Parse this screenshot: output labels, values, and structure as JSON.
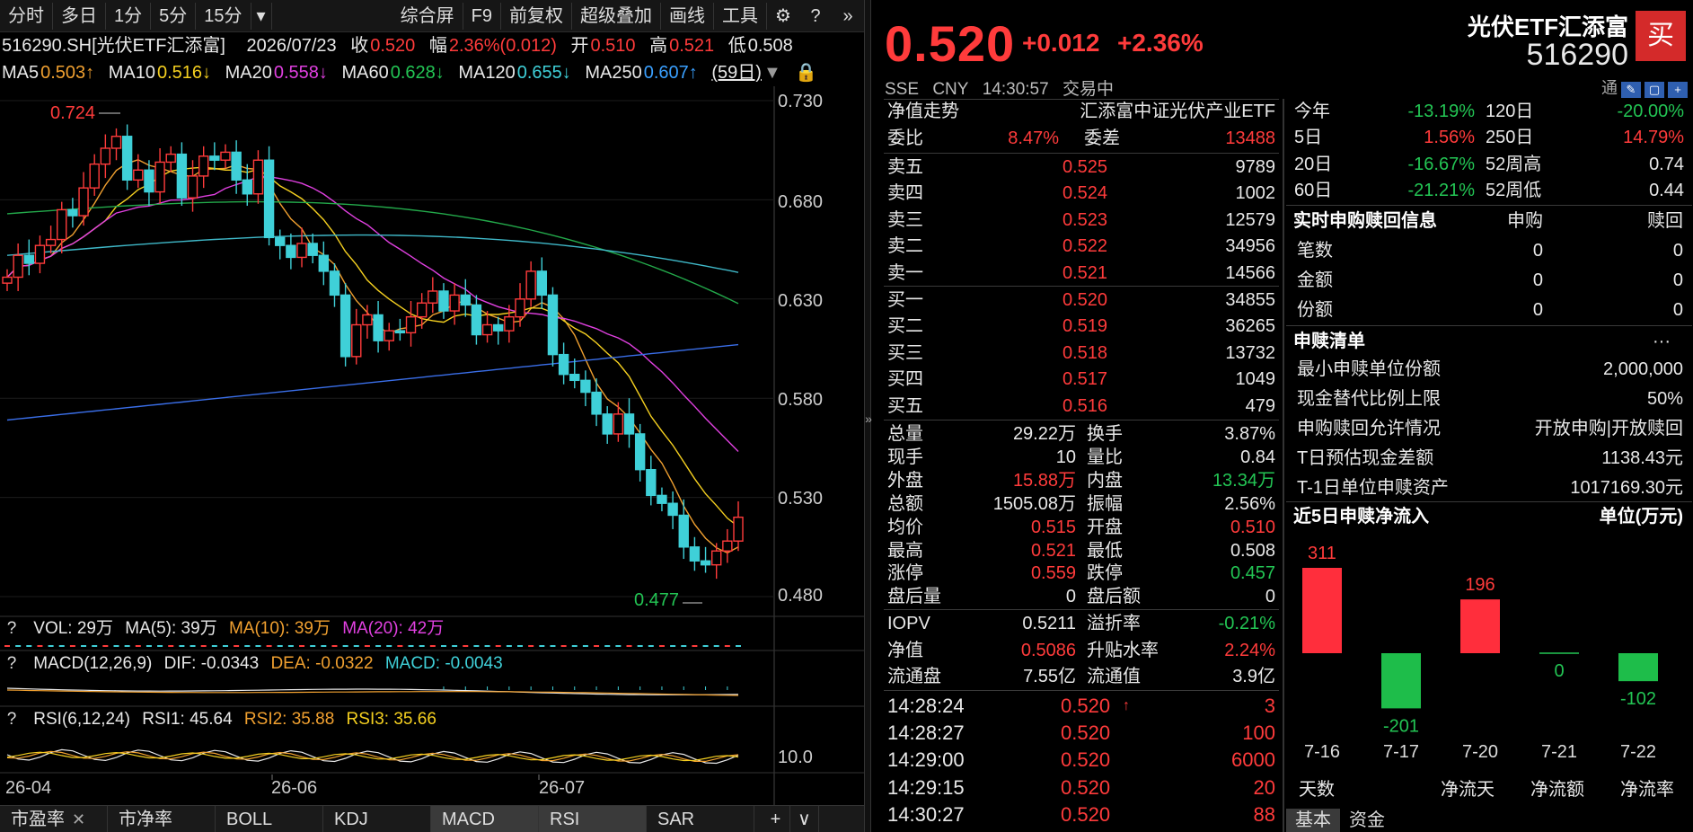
{
  "toolbar": {
    "items": [
      "分时",
      "多日",
      "1分",
      "5分",
      "15分",
      "综合屏",
      "F9",
      "前复权",
      "超级叠加",
      "画线",
      "工具"
    ],
    "more": "▾",
    "gear": "⚙",
    "help": "?",
    "collapse": "»"
  },
  "info": {
    "code": "516290.SH[光伏ETF汇添富]",
    "date": "2026/07/23",
    "close_label": "收",
    "close": "0.520",
    "range_label": "幅",
    "range": "2.36%(0.012)",
    "open_label": "开",
    "open": "0.510",
    "high_label": "高",
    "high": "0.521",
    "low_label": "低",
    "low": "0.508"
  },
  "ma": {
    "ma5": "MA5",
    "ma5v": "0.503↑",
    "ma10": "MA10",
    "ma10v": "0.516↓",
    "ma20": "MA20",
    "ma20v": "0.558↓",
    "ma60": "MA60",
    "ma60v": "0.628↓",
    "ma120": "MA120",
    "ma120v": "0.655↓",
    "ma250": "MA250",
    "ma250v": "0.607↑",
    "days": "(59日)"
  },
  "price_axis": [
    "0.730",
    "0.680",
    "0.630",
    "0.580",
    "0.530",
    "0.480"
  ],
  "annot": {
    "high": "0.724",
    "low": "0.477"
  },
  "vol": {
    "q": "?",
    "label": "VOL: 29万",
    "ma5": "MA(5): 39万",
    "ma10": "MA(10): 39万",
    "ma20": "MA(20): 42万"
  },
  "macd": {
    "q": "?",
    "label": "MACD(12,26,9)",
    "dif": "DIF: -0.0343",
    "dea": "DEA: -0.0322",
    "macd": "MACD: -0.0043"
  },
  "rsi": {
    "q": "?",
    "label": "RSI(6,12,24)",
    "rsi1": "RSI1: 45.64",
    "rsi2": "RSI2: 35.88",
    "rsi3": "RSI3: 35.66",
    "axis": "10.0"
  },
  "xaxis": [
    "26-04",
    "26-06",
    "26-07"
  ],
  "bottom_tabs": [
    "市盈率",
    "市净率",
    "BOLL",
    "KDJ",
    "MACD",
    "RSI",
    "SAR"
  ],
  "bottom_tab_close": "✕",
  "bottom_icons": [
    "+",
    "∨"
  ],
  "quote": {
    "price": "0.520",
    "change": "+0.012",
    "pct": "+2.36%",
    "exchange": "SSE",
    "currency": "CNY",
    "time": "14:30:57",
    "status": "交易中",
    "name": "光伏ETF汇添富",
    "code": "516290",
    "buy": "买",
    "tong": "通"
  },
  "nav": {
    "label": "净值走势",
    "fund": "汇添富中证光伏产业ETF"
  },
  "wei": {
    "wb_label": "委比",
    "wb": "8.47%",
    "wc_label": "委差",
    "wc": "13488"
  },
  "asks": [
    {
      "l": "卖五",
      "p": "0.525",
      "v": "9789"
    },
    {
      "l": "卖四",
      "p": "0.524",
      "v": "1002"
    },
    {
      "l": "卖三",
      "p": "0.523",
      "v": "12579"
    },
    {
      "l": "卖二",
      "p": "0.522",
      "v": "34956"
    },
    {
      "l": "卖一",
      "p": "0.521",
      "v": "14566"
    }
  ],
  "bids": [
    {
      "l": "买一",
      "p": "0.520",
      "v": "34855"
    },
    {
      "l": "买二",
      "p": "0.519",
      "v": "36265"
    },
    {
      "l": "买三",
      "p": "0.518",
      "v": "13732"
    },
    {
      "l": "买四",
      "p": "0.517",
      "v": "1049"
    },
    {
      "l": "买五",
      "p": "0.516",
      "v": "479"
    }
  ],
  "stats": [
    {
      "l1": "总量",
      "v1": "29.22万",
      "c1": "wh",
      "l2": "换手",
      "v2": "3.87%",
      "c2": "wh"
    },
    {
      "l1": "现手",
      "v1": "10",
      "c1": "wh",
      "l2": "量比",
      "v2": "0.84",
      "c2": "wh"
    },
    {
      "l1": "外盘",
      "v1": "15.88万",
      "c1": "up",
      "l2": "内盘",
      "v2": "13.34万",
      "c2": "dn"
    },
    {
      "l1": "总额",
      "v1": "1505.08万",
      "c1": "wh",
      "l2": "振幅",
      "v2": "2.56%",
      "c2": "wh"
    },
    {
      "l1": "均价",
      "v1": "0.515",
      "c1": "up",
      "l2": "开盘",
      "v2": "0.510",
      "c2": "up"
    },
    {
      "l1": "最高",
      "v1": "0.521",
      "c1": "up",
      "l2": "最低",
      "v2": "0.508",
      "c2": "wh"
    },
    {
      "l1": "涨停",
      "v1": "0.559",
      "c1": "up",
      "l2": "跌停",
      "v2": "0.457",
      "c2": "dn"
    },
    {
      "l1": "盘后量",
      "v1": "0",
      "c1": "wh",
      "l2": "盘后额",
      "v2": "0",
      "c2": "wh"
    }
  ],
  "iopv": [
    {
      "l1": "IOPV",
      "v1": "0.5211",
      "c1": "wh",
      "l2": "溢折率",
      "v2": "-0.21%",
      "c2": "dn"
    },
    {
      "l1": "净值",
      "v1": "0.5086",
      "c1": "up",
      "l2": "升贴水率",
      "v2": "2.24%",
      "c2": "up"
    },
    {
      "l1": "流通盘",
      "v1": "7.55亿",
      "c1": "wh",
      "l2": "流通值",
      "v2": "3.9亿",
      "c2": "wh"
    }
  ],
  "ticks": [
    {
      "t": "14:28:24",
      "p": "0.520",
      "arrow": "↑",
      "v": "3"
    },
    {
      "t": "14:28:27",
      "p": "0.520",
      "arrow": "",
      "v": "100"
    },
    {
      "t": "14:29:00",
      "p": "0.520",
      "arrow": "",
      "v": "6000"
    },
    {
      "t": "14:29:15",
      "p": "0.520",
      "arrow": "",
      "v": "20"
    },
    {
      "t": "14:30:27",
      "p": "0.520",
      "arrow": "",
      "v": "88"
    }
  ],
  "perf": [
    {
      "l1": "今年",
      "v1": "-13.19%",
      "c1": "dn",
      "l2": "120日",
      "v2": "-20.00%",
      "c2": "dn"
    },
    {
      "l1": "5日",
      "v1": "1.56%",
      "c1": "up",
      "l2": "250日",
      "v2": "14.79%",
      "c2": "up"
    },
    {
      "l1": "20日",
      "v1": "-16.67%",
      "c1": "dn",
      "l2": "52周高",
      "v2": "0.74",
      "c2": "wh"
    },
    {
      "l1": "60日",
      "v1": "-21.21%",
      "c1": "dn",
      "l2": "52周低",
      "v2": "0.44",
      "c2": "wh"
    }
  ],
  "realtime": {
    "title": "实时申购赎回信息",
    "h1": "申购",
    "h2": "赎回",
    "rows": [
      {
        "l": "笔数",
        "a": "0",
        "b": "0"
      },
      {
        "l": "金额",
        "a": "0",
        "b": "0"
      },
      {
        "l": "份额",
        "a": "0",
        "b": "0"
      }
    ]
  },
  "list": {
    "title": "申赎清单",
    "more": "···",
    "rows": [
      {
        "l": "最小申赎单位份额",
        "v": "2,000,000"
      },
      {
        "l": "现金替代比例上限",
        "v": "50%"
      },
      {
        "l": "申购赎回允许情况",
        "v": "开放申购|开放赎回"
      },
      {
        "l": "T日预估现金差额",
        "v": "1138.43元"
      },
      {
        "l": "T-1日单位申赎资产",
        "v": "1017169.30元"
      }
    ]
  },
  "flow": {
    "title": "近5日申赎净流入",
    "unit": "单位(万元)",
    "footer": [
      "天数",
      "净流天",
      "净流额",
      "净流率"
    ]
  },
  "chart_data": {
    "type": "bar",
    "categories": [
      "7-16",
      "7-17",
      "7-20",
      "7-21",
      "7-22"
    ],
    "values": [
      311,
      -201,
      196,
      0,
      -102
    ],
    "title": "近5日申赎净流入",
    "ylabel": "单位(万元)"
  },
  "right_tabs": [
    "基本",
    "资金"
  ]
}
